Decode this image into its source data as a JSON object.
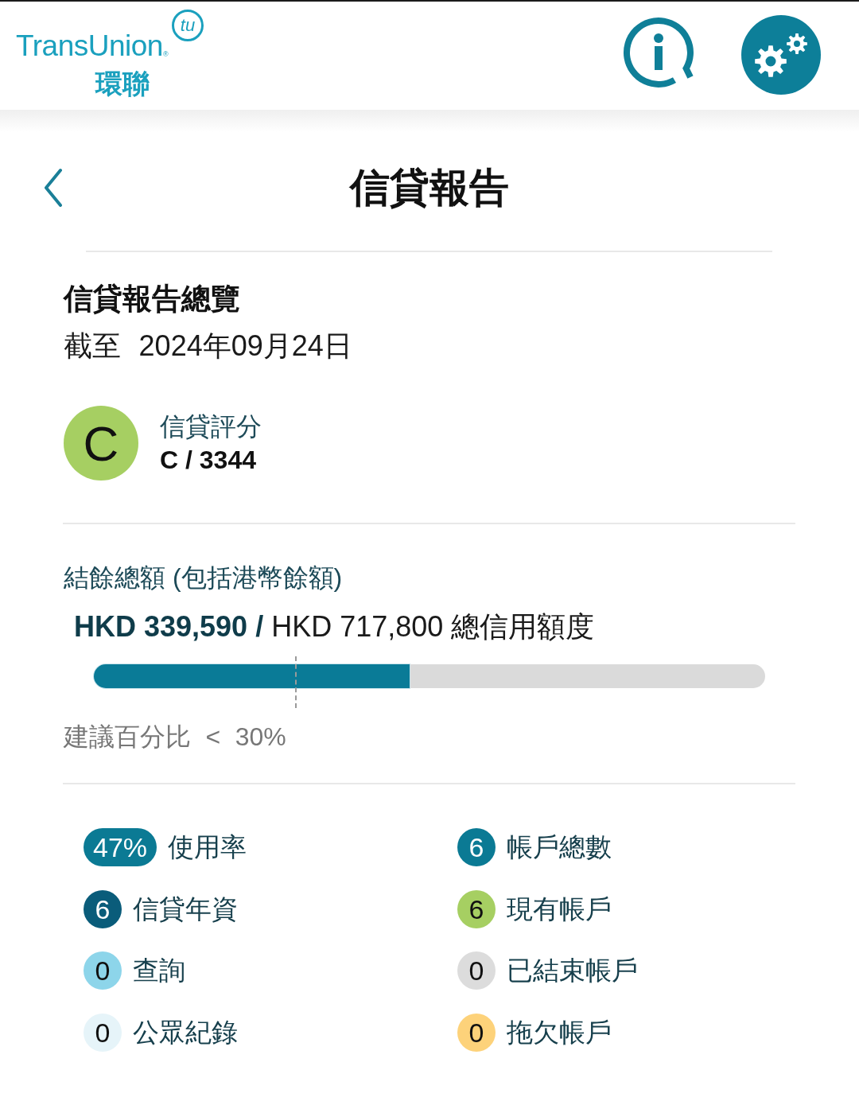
{
  "header": {
    "logo": {
      "wordmark": "TransUnion",
      "registered": "®",
      "mark": "tu",
      "chinese_name": "環聯"
    }
  },
  "title_bar": {
    "title": "信貸報告"
  },
  "overview": {
    "heading": "信貸報告總覽",
    "as_of": "截至 2024年09月24日",
    "score": {
      "grade": "C",
      "label": "信貸評分",
      "value": "C / 3344"
    }
  },
  "balance": {
    "label": "結餘總額 (包括港幣餘額)",
    "amounts": "**HKD 339,590 /** HKD 717,800 總信用額度",
    "meter": {
      "level": 0.47
    },
    "threshold": {
      "level": 0.3
    },
    "recommendation": "建議百分比 < 30%"
  },
  "stats": [
    {
      "value": "47%",
      "label": "使用率",
      "color": "#0b7a94"
    },
    {
      "value": "6",
      "label": "帳戶總數",
      "color": "#0b7a94"
    },
    {
      "value": "6",
      "label": "信貸年資",
      "color": "#0a5c7a"
    },
    {
      "value": "6",
      "label": "現有帳戶",
      "color": "#a6cf62"
    },
    {
      "value": "0",
      "label": "查詢",
      "color": "#8dd5ea"
    },
    {
      "value": "0",
      "label": "已結束帳戶",
      "color": "#dcdcdc"
    },
    {
      "value": "0",
      "label": "公眾紀錄",
      "color": "#e6f4f9"
    },
    {
      "value": "0",
      "label": "拖欠帳戶",
      "color": "#fdd27a"
    }
  ]
}
